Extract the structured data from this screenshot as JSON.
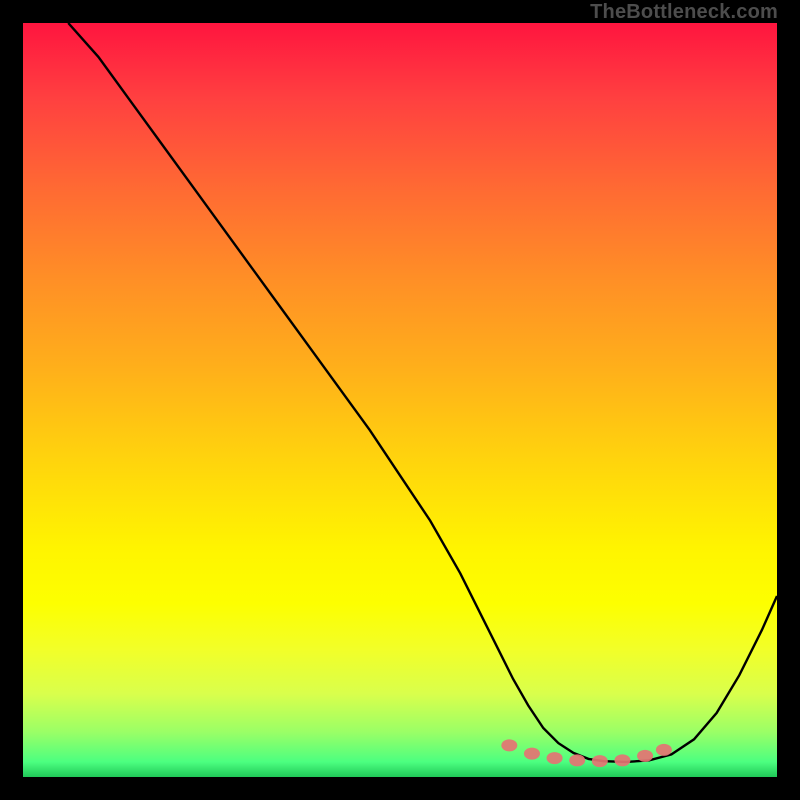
{
  "watermark": "TheBottleneck.com",
  "chart_data": {
    "type": "line",
    "title": "",
    "xlabel": "",
    "ylabel": "",
    "xlim": [
      0,
      100
    ],
    "ylim": [
      0,
      100
    ],
    "series": [
      {
        "name": "bottleneck-curve",
        "x": [
          6,
          10,
          14,
          18,
          22,
          26,
          30,
          34,
          38,
          42,
          46,
          50,
          54,
          58,
          61,
          63,
          65,
          67,
          69,
          71,
          73,
          75,
          77,
          80,
          83,
          86,
          89,
          92,
          95,
          98,
          100
        ],
        "y": [
          100,
          95.5,
          90,
          84.5,
          79,
          73.5,
          68,
          62.5,
          57,
          51.5,
          46,
          40,
          34,
          27,
          21,
          17,
          13,
          9.5,
          6.5,
          4.5,
          3.2,
          2.4,
          2.1,
          2.0,
          2.2,
          3.0,
          5.0,
          8.5,
          13.5,
          19.5,
          24
        ]
      }
    ],
    "markers": {
      "name": "optimal-range-markers",
      "color": "#e57373",
      "points": [
        {
          "x": 64.5,
          "y": 4.2
        },
        {
          "x": 67.5,
          "y": 3.1
        },
        {
          "x": 70.5,
          "y": 2.5
        },
        {
          "x": 73.5,
          "y": 2.2
        },
        {
          "x": 76.5,
          "y": 2.1
        },
        {
          "x": 79.5,
          "y": 2.2
        },
        {
          "x": 82.5,
          "y": 2.8
        },
        {
          "x": 85.0,
          "y": 3.6
        }
      ]
    }
  }
}
